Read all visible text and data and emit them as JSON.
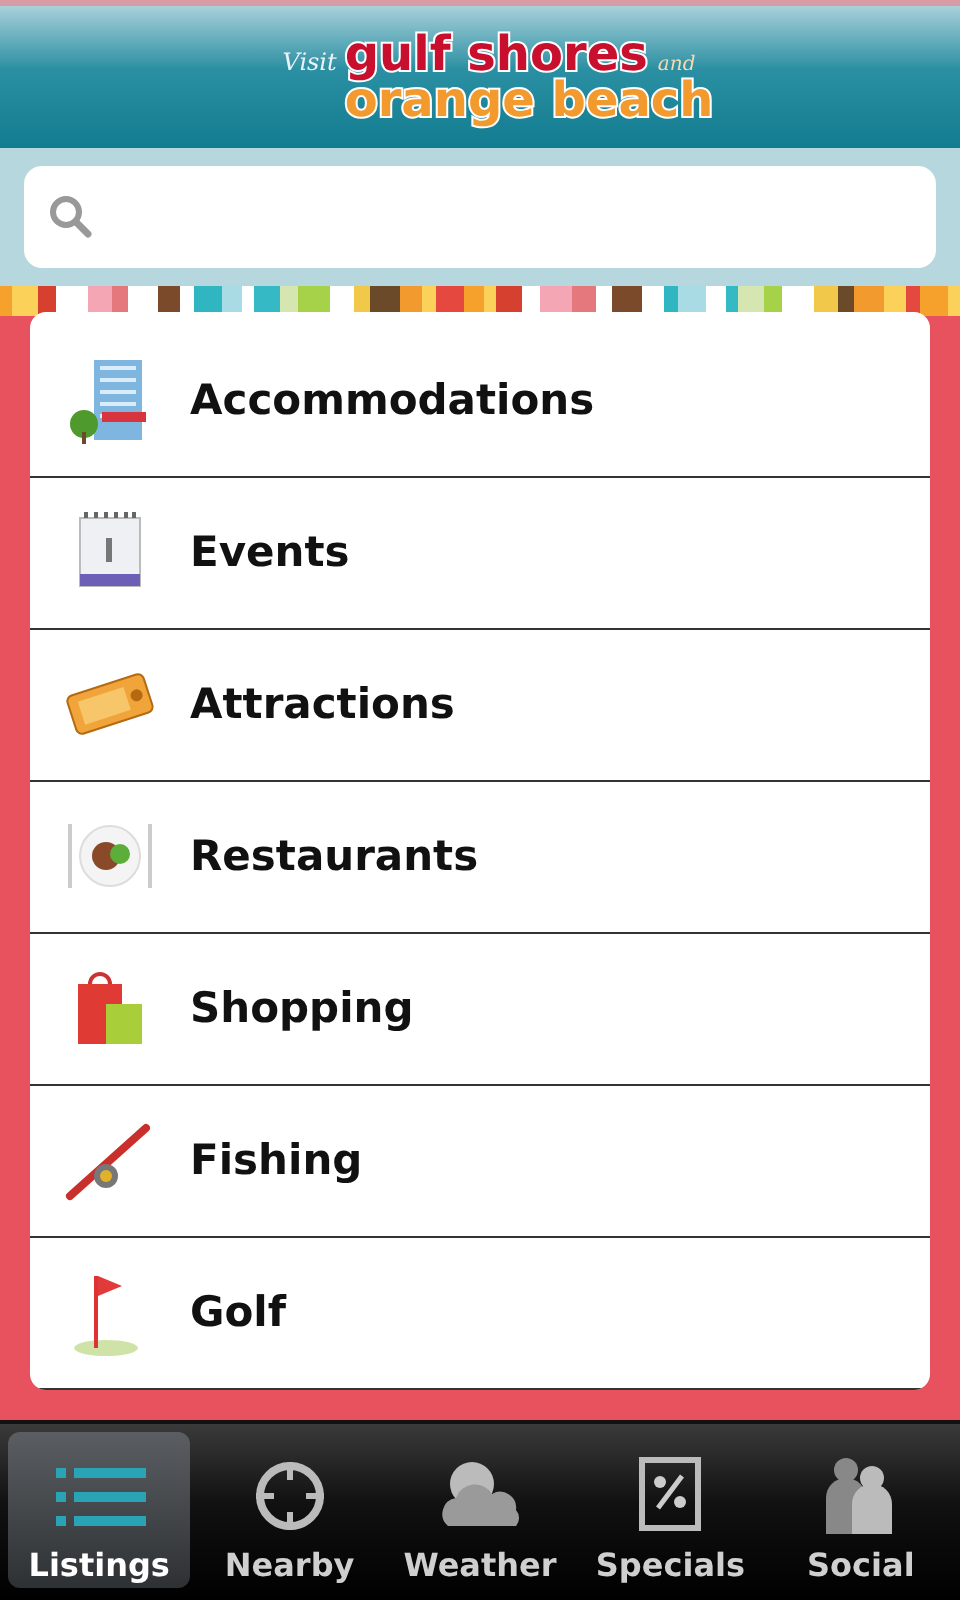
{
  "logo": {
    "visit": "Visit",
    "line_1": "gulf shores",
    "and": "and",
    "line_2": "orange beach"
  },
  "search": {
    "kind": "search"
  },
  "listings": [
    {
      "label": "Accommodations",
      "kind": "hotel"
    },
    {
      "label": "Events",
      "kind": "calendar"
    },
    {
      "label": "Attractions",
      "kind": "ticket"
    },
    {
      "label": "Restaurants",
      "kind": "plate"
    },
    {
      "label": "Shopping",
      "kind": "bags"
    },
    {
      "label": "Fishing",
      "kind": "rod"
    },
    {
      "label": "Golf",
      "kind": "flag"
    }
  ],
  "tabs": [
    {
      "label": "Listings",
      "kind": "list",
      "selected": true
    },
    {
      "label": "Nearby",
      "kind": "target",
      "selected": false
    },
    {
      "label": "Weather",
      "kind": "cloud",
      "selected": false
    },
    {
      "label": "Specials",
      "kind": "percent",
      "selected": false
    },
    {
      "label": "Social",
      "kind": "people",
      "selected": false
    }
  ]
}
